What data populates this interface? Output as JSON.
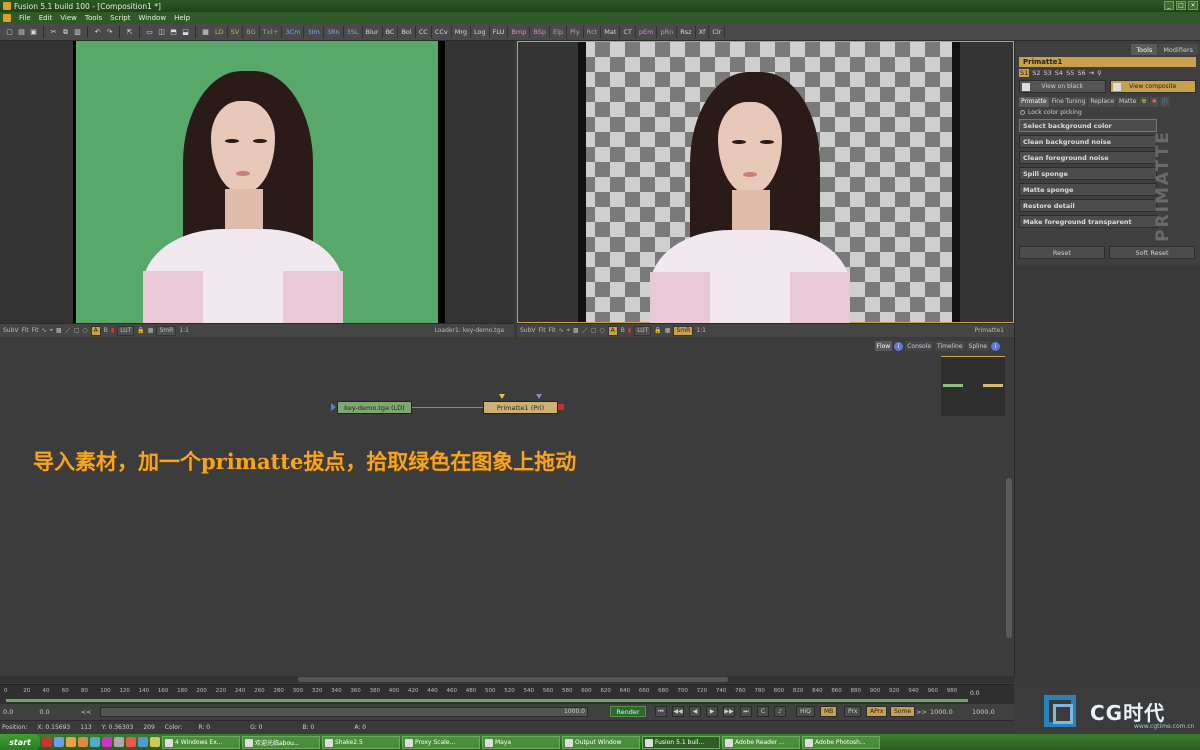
{
  "window": {
    "title": "Fusion 5.1 build 100 - [Composition1 *]",
    "controls": [
      "_",
      "□",
      "×"
    ]
  },
  "menu": [
    "File",
    "Edit",
    "View",
    "Tools",
    "Script",
    "Window",
    "Help"
  ],
  "toolbar": {
    "tools": [
      "LD",
      "SV",
      "BG",
      "Txt+",
      "3Cm",
      "3Im",
      "3Rn",
      "3SL",
      "Blur",
      "BC",
      "Bol",
      "CC",
      "CCv",
      "Mrg",
      "Log",
      "FLU",
      "Bmp",
      "BSp",
      "Elp",
      "Ply",
      "Rct",
      "Mat",
      "CT",
      "pEm",
      "pRn",
      "Rsz",
      "Xf",
      "Clr"
    ]
  },
  "viewer_left": {
    "footer": [
      "SubV",
      "Fit",
      "Fit"
    ],
    "label": "Loader1: key-demo.tga",
    "lut": "LUT",
    "smr": "SmR",
    "ratio": "1:1"
  },
  "viewer_right": {
    "footer": [
      "SubV",
      "Fit",
      "Fit"
    ],
    "label": "Primatte1",
    "lut": "LUT",
    "smr": "SmR",
    "ratio": "1:1"
  },
  "channels": [
    "A",
    "B"
  ],
  "right_panel": {
    "tabs": [
      "Tools",
      "Modifiers"
    ],
    "tool_name": "Primatte1",
    "slots": [
      "S1",
      "S2",
      "S3",
      "S4",
      "S5",
      "S6"
    ],
    "view_buttons": [
      "View on black",
      "View composite"
    ],
    "subtabs": [
      "Primatte",
      "Fine Tuning",
      "Replace",
      "Matte"
    ],
    "lock": "Lock color picking",
    "operations": [
      "Select background color",
      "Clean background noise",
      "Clean foreground noise",
      "Spill sponge",
      "Matte sponge",
      "Restore detail",
      "Make foreground transparent"
    ],
    "logo": "PRIMATTE",
    "bottom_buttons": [
      "Reset",
      "Soft Reset"
    ]
  },
  "flow": {
    "tabs": [
      "Flow",
      "Console",
      "Timeline",
      "Spline"
    ],
    "nodes": {
      "loader": "key-demo.tga (LD)",
      "primatte": "Primatte1 (Pri)"
    },
    "caption": "导入素材，加一个primatte拔点，拾取绿色在图象上拖动"
  },
  "timeline": {
    "ticks": [
      "0",
      "20",
      "40",
      "60",
      "80",
      "100",
      "120",
      "140",
      "160",
      "180",
      "200",
      "220",
      "240",
      "260",
      "280",
      "300",
      "320",
      "340",
      "360",
      "380",
      "400",
      "420",
      "440",
      "460",
      "480",
      "500",
      "520",
      "540",
      "560",
      "580",
      "600",
      "620",
      "640",
      "660",
      "680",
      "700",
      "720",
      "740",
      "760",
      "780",
      "800",
      "820",
      "840",
      "860",
      "880",
      "900",
      "920",
      "940",
      "960",
      "980"
    ],
    "end_value": "0.0"
  },
  "range": {
    "start": "0.0",
    "current": "0.0",
    "rewind": "<<",
    "track_end": "1000.0",
    "render": "Render",
    "options": [
      "HiQ",
      "MB",
      "Prx",
      "APrx",
      "Some"
    ],
    "forward": ">>",
    "end1": "1000.0",
    "end2": "1000.0"
  },
  "status": {
    "position_label": "Position:",
    "x": "X: 0.15693",
    "x_px": "113",
    "y": "Y: 0.36303",
    "y_px": "209",
    "color_label": "Color:",
    "r": "R: 0",
    "g": "G: 0",
    "b": "B: 0",
    "a": "A: 0"
  },
  "watermark": {
    "brand": "CG时代",
    "url": "www.cgtime.com.cn"
  },
  "taskbar": {
    "start": "start",
    "tasks": [
      "4 Windows Ex...",
      "欢迎光临abou...",
      "Shake2.5",
      "Proxy Scale...",
      "Maya",
      "Output Window",
      "Fusion 5.1 buil...",
      "Adobe Reader ...",
      "Adobe Photosh..."
    ]
  }
}
